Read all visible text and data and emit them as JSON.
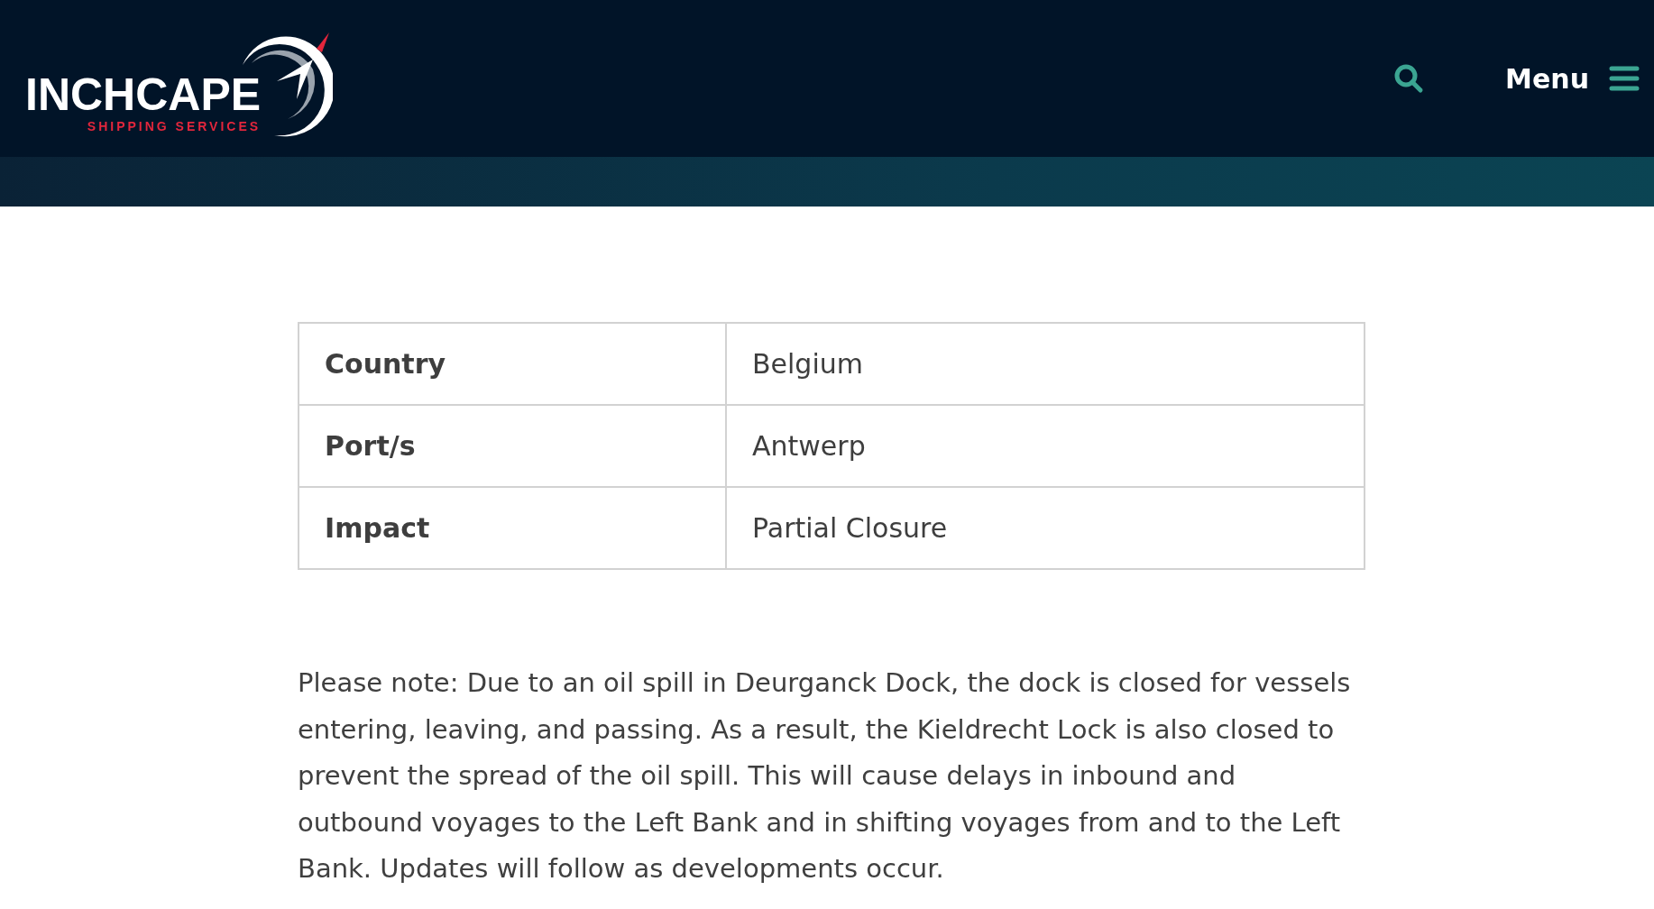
{
  "header": {
    "logo": {
      "name": "INCHCAPE",
      "tagline": "SHIPPING SERVICES"
    },
    "menu_label": "Menu"
  },
  "table": {
    "rows": [
      {
        "label": "Country",
        "value": "Belgium"
      },
      {
        "label": "Port/s",
        "value": "Antwerp"
      },
      {
        "label": "Impact",
        "value": "Partial Closure"
      }
    ]
  },
  "notice": "Please note: Due to an oil spill in Deurganck Dock, the dock is closed for vessels entering, leaving, and passing. As a result, the Kieldrecht Lock is also closed to prevent the spread of the oil spill. This will cause delays in inbound and outbound voyages to the Left Bank and in shifting voyages from and to the Left Bank. Updates will follow as developments occur."
}
